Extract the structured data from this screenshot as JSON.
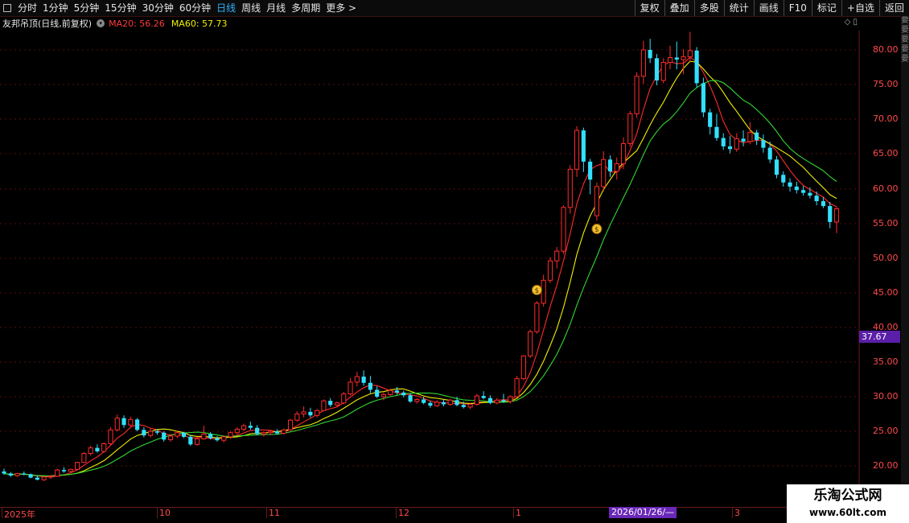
{
  "toolbar": {
    "left_items": [
      {
        "label": "分时"
      },
      {
        "label": "1分钟"
      },
      {
        "label": "5分钟"
      },
      {
        "label": "15分钟"
      },
      {
        "label": "30分钟"
      },
      {
        "label": "60分钟"
      },
      {
        "label": "日线",
        "active": true
      },
      {
        "label": "周线"
      },
      {
        "label": "月线"
      },
      {
        "label": "多周期"
      },
      {
        "label": "更多 >"
      }
    ],
    "right_items": [
      {
        "label": "复权"
      },
      {
        "label": "叠加"
      },
      {
        "label": "多股"
      },
      {
        "label": "统计"
      },
      {
        "label": "画线"
      },
      {
        "label": "F10"
      },
      {
        "label": "标记"
      },
      {
        "label": "+自选"
      },
      {
        "label": "返回"
      }
    ]
  },
  "info": {
    "title": "友邦吊顶(日线,前复权)",
    "ma20": "MA20: 56.26",
    "ma60": "MA60: 57.73"
  },
  "price_axis": [
    "80.00",
    "75.00",
    "70.00",
    "65.00",
    "60.00",
    "55.00",
    "50.00",
    "45.00",
    "40.00",
    "35.00",
    "30.00",
    "25.00",
    "20.00"
  ],
  "current_price_tag": "37.67",
  "date_axis": [
    "2025年",
    "10",
    "11",
    "12",
    "1",
    "3"
  ],
  "date_marker": "2026/01/26/—",
  "watermark": {
    "line1": "乐淘公式网",
    "line2": "www.60lt.com"
  },
  "colors": {
    "up": "#ff2b2b",
    "down": "#33e0ff",
    "ma20": "#f0f000",
    "ma60": "#33d633",
    "marker_purple": "#6a28b8"
  },
  "chart_data": {
    "type": "candlestick",
    "y_axis_labels": [
      "80.00",
      "75.00",
      "70.00",
      "65.00",
      "60.00",
      "55.00",
      "50.00",
      "45.00",
      "40.00",
      "35.00",
      "30.00",
      "25.00",
      "20.00"
    ],
    "date_range": "2025年 – 2026年3月",
    "candles": [
      [
        19.2,
        19.6,
        18.7,
        18.9
      ],
      [
        18.9,
        19.1,
        18.4,
        18.6
      ],
      [
        18.6,
        19.0,
        18.4,
        18.9
      ],
      [
        18.9,
        19.2,
        18.6,
        18.8
      ],
      [
        18.8,
        18.9,
        18.2,
        18.3
      ],
      [
        18.3,
        18.6,
        17.9,
        18.0
      ],
      [
        18.0,
        18.5,
        17.8,
        18.4
      ],
      [
        18.4,
        18.7,
        18.1,
        18.5
      ],
      [
        18.5,
        19.6,
        18.4,
        19.4
      ],
      [
        19.4,
        19.8,
        19.0,
        19.2
      ],
      [
        19.2,
        19.6,
        18.9,
        19.5
      ],
      [
        19.5,
        20.6,
        19.4,
        20.5
      ],
      [
        20.5,
        22.0,
        20.4,
        21.8
      ],
      [
        21.8,
        22.9,
        21.5,
        22.6
      ],
      [
        22.6,
        23.1,
        21.9,
        22.1
      ],
      [
        22.1,
        23.4,
        21.9,
        23.2
      ],
      [
        23.2,
        25.6,
        23.0,
        25.2
      ],
      [
        25.2,
        27.4,
        25.0,
        26.9
      ],
      [
        26.9,
        27.3,
        25.5,
        25.9
      ],
      [
        25.9,
        27.1,
        25.6,
        26.7
      ],
      [
        26.7,
        26.9,
        25.0,
        25.2
      ],
      [
        25.2,
        25.6,
        24.1,
        24.4
      ],
      [
        24.4,
        25.4,
        24.1,
        25.0
      ],
      [
        25.0,
        25.3,
        24.5,
        24.8
      ],
      [
        24.8,
        25.0,
        23.5,
        23.8
      ],
      [
        23.8,
        24.6,
        23.5,
        24.3
      ],
      [
        24.3,
        25.1,
        24.0,
        24.8
      ],
      [
        24.8,
        24.9,
        24.0,
        24.2
      ],
      [
        24.2,
        24.5,
        22.9,
        23.1
      ],
      [
        23.1,
        24.2,
        22.9,
        23.9
      ],
      [
        23.9,
        25.8,
        23.8,
        24.6
      ],
      [
        24.6,
        24.9,
        23.8,
        24.0
      ],
      [
        24.0,
        24.3,
        23.5,
        23.7
      ],
      [
        23.7,
        24.4,
        23.4,
        24.2
      ],
      [
        24.2,
        25.0,
        23.9,
        24.8
      ],
      [
        24.8,
        25.6,
        24.5,
        25.3
      ],
      [
        25.3,
        26.1,
        25.0,
        25.8
      ],
      [
        25.8,
        26.4,
        25.2,
        25.5
      ],
      [
        25.5,
        25.9,
        24.4,
        24.6
      ],
      [
        24.6,
        25.0,
        24.2,
        24.8
      ],
      [
        24.8,
        25.2,
        24.4,
        25.0
      ],
      [
        25.0,
        25.3,
        24.5,
        24.7
      ],
      [
        24.7,
        25.4,
        24.5,
        25.2
      ],
      [
        25.2,
        26.8,
        25.1,
        26.6
      ],
      [
        26.6,
        27.9,
        26.4,
        27.5
      ],
      [
        27.5,
        28.6,
        27.0,
        27.8
      ],
      [
        27.8,
        28.4,
        27.0,
        27.3
      ],
      [
        27.3,
        28.2,
        27.0,
        28.0
      ],
      [
        28.0,
        29.6,
        27.9,
        29.4
      ],
      [
        29.4,
        29.8,
        28.5,
        28.8
      ],
      [
        28.8,
        29.3,
        28.6,
        29.1
      ],
      [
        29.1,
        30.7,
        28.9,
        30.4
      ],
      [
        30.4,
        32.7,
        30.2,
        32.1
      ],
      [
        32.1,
        33.6,
        31.5,
        32.9
      ],
      [
        32.9,
        33.8,
        31.6,
        32.0
      ],
      [
        32.0,
        33.0,
        30.5,
        31.0
      ],
      [
        31.0,
        31.5,
        29.8,
        30.0
      ],
      [
        30.0,
        30.6,
        29.5,
        30.3
      ],
      [
        30.3,
        31.2,
        30.1,
        30.9
      ],
      [
        30.9,
        31.4,
        30.3,
        30.6
      ],
      [
        30.6,
        30.9,
        29.9,
        30.2
      ],
      [
        30.2,
        30.5,
        29.1,
        29.3
      ],
      [
        29.3,
        29.8,
        29.0,
        29.6
      ],
      [
        29.6,
        30.0,
        28.9,
        29.1
      ],
      [
        29.1,
        29.4,
        28.4,
        28.7
      ],
      [
        28.7,
        29.5,
        28.5,
        29.2
      ],
      [
        29.2,
        29.6,
        28.6,
        28.9
      ],
      [
        28.9,
        29.7,
        28.7,
        29.5
      ],
      [
        29.5,
        30.0,
        28.6,
        28.8
      ],
      [
        28.8,
        29.3,
        28.3,
        28.5
      ],
      [
        28.5,
        29.1,
        28.2,
        28.9
      ],
      [
        28.9,
        30.4,
        28.7,
        30.1
      ],
      [
        30.1,
        30.8,
        29.6,
        29.8
      ],
      [
        29.8,
        30.2,
        28.9,
        29.1
      ],
      [
        29.1,
        29.8,
        28.9,
        29.5
      ],
      [
        29.5,
        30.4,
        29.1,
        29.3
      ],
      [
        29.3,
        30.2,
        29.0,
        30.0
      ],
      [
        30.0,
        33.0,
        29.8,
        32.6
      ],
      [
        32.6,
        36.0,
        32.4,
        35.9
      ],
      [
        35.9,
        39.7,
        35.6,
        39.4
      ],
      [
        39.4,
        43.8,
        39.1,
        43.5
      ],
      [
        43.5,
        47.6,
        43.0,
        46.8
      ],
      [
        46.8,
        50.1,
        46.4,
        49.6
      ],
      [
        49.6,
        51.6,
        48.5,
        51.0
      ],
      [
        51.0,
        57.6,
        50.6,
        57.3
      ],
      [
        57.3,
        63.4,
        56.4,
        62.8
      ],
      [
        62.8,
        69.0,
        61.7,
        68.4
      ],
      [
        68.4,
        68.8,
        62.4,
        63.9
      ],
      [
        63.9,
        64.3,
        59.2,
        61.3
      ],
      [
        56.1,
        60.9,
        55.4,
        60.3
      ],
      [
        60.3,
        65.4,
        59.6,
        64.2
      ],
      [
        64.2,
        64.8,
        61.7,
        62.5
      ],
      [
        62.5,
        64.5,
        61.3,
        63.6
      ],
      [
        63.6,
        67.4,
        62.8,
        66.5
      ],
      [
        66.5,
        71.2,
        66.0,
        70.8
      ],
      [
        70.8,
        76.8,
        70.2,
        76.2
      ],
      [
        76.2,
        81.3,
        75.1,
        80.0
      ],
      [
        80.0,
        81.6,
        78.1,
        78.8
      ],
      [
        78.8,
        79.4,
        74.9,
        75.6
      ],
      [
        75.6,
        78.8,
        75.2,
        78.2
      ],
      [
        78.2,
        80.6,
        77.2,
        78.9
      ],
      [
        78.9,
        81.2,
        77.2,
        78.6
      ],
      [
        78.6,
        80.1,
        76.5,
        79.0
      ],
      [
        79.0,
        82.6,
        78.2,
        79.9
      ],
      [
        79.9,
        80.4,
        74.6,
        75.2
      ],
      [
        75.2,
        76.0,
        70.3,
        71.0
      ],
      [
        71.0,
        71.5,
        67.8,
        68.9
      ],
      [
        68.9,
        70.8,
        66.9,
        67.3
      ],
      [
        67.3,
        68.0,
        65.6,
        66.1
      ],
      [
        66.1,
        67.6,
        65.1,
        65.7
      ],
      [
        65.7,
        68.0,
        65.3,
        67.2
      ],
      [
        67.2,
        68.4,
        66.1,
        66.8
      ],
      [
        66.8,
        69.6,
        66.4,
        68.1
      ],
      [
        68.1,
        68.5,
        66.3,
        67.0
      ],
      [
        67.0,
        67.8,
        65.2,
        65.9
      ],
      [
        65.9,
        66.8,
        63.7,
        64.2
      ],
      [
        64.2,
        64.7,
        61.5,
        62.0
      ],
      [
        62.0,
        62.5,
        60.3,
        60.9
      ],
      [
        60.9,
        61.5,
        59.6,
        60.3
      ],
      [
        60.3,
        61.0,
        59.3,
        59.8
      ],
      [
        59.8,
        60.4,
        59.0,
        59.4
      ],
      [
        59.4,
        60.2,
        58.6,
        59.0
      ],
      [
        59.0,
        59.6,
        57.6,
        58.2
      ],
      [
        58.2,
        58.8,
        57.2,
        57.5
      ],
      [
        57.5,
        58.1,
        54.3,
        55.2
      ],
      [
        55.2,
        57.4,
        53.6,
        57.1
      ]
    ]
  }
}
